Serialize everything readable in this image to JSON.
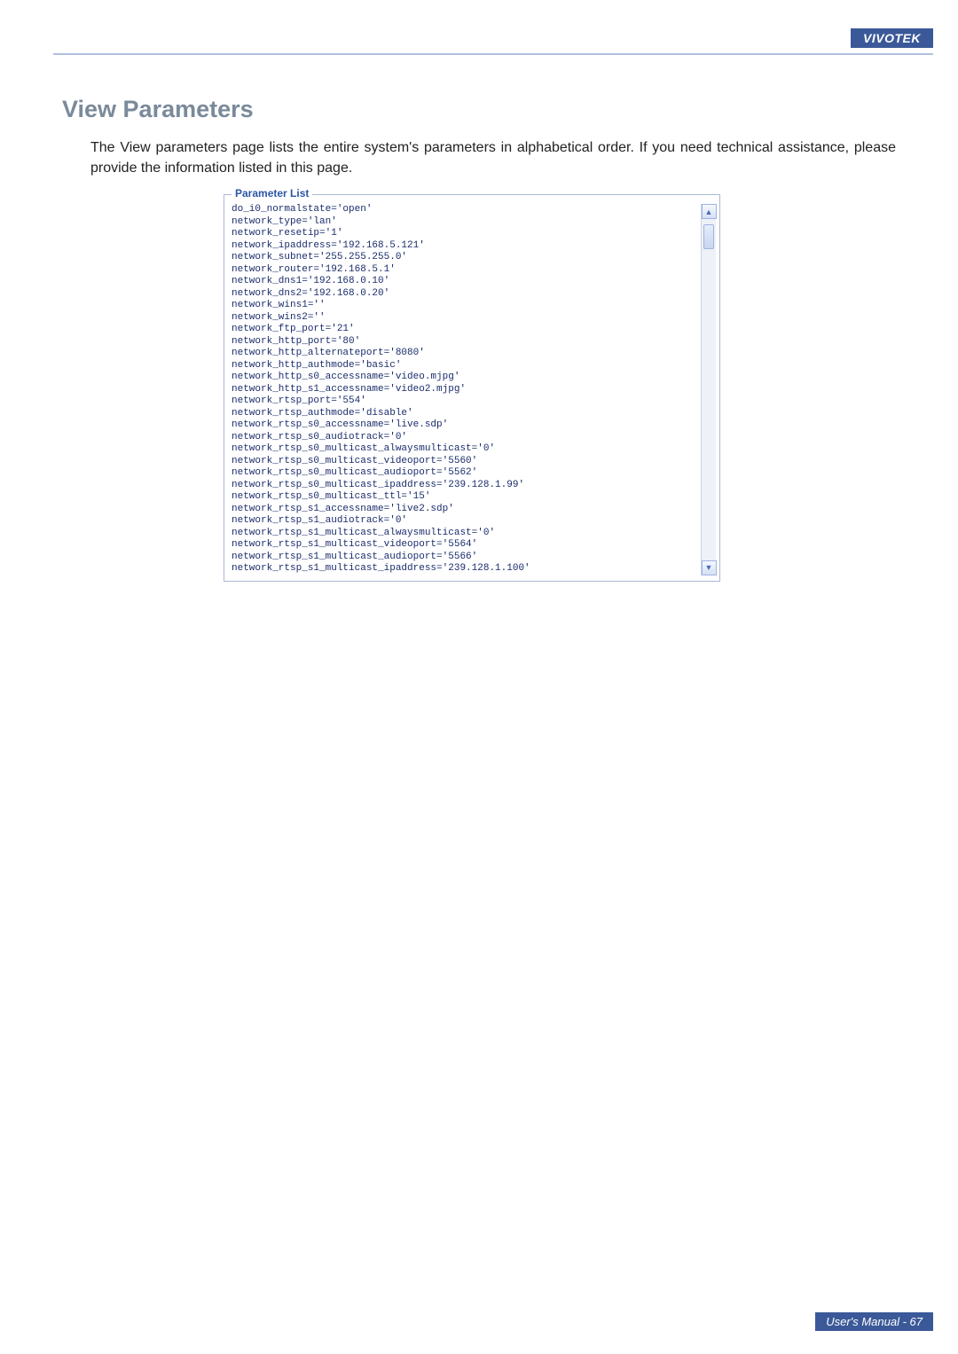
{
  "brand": "VIVOTEK",
  "title": "View Parameters",
  "intro": "The View parameters page lists the entire system's parameters in alphabetical order. If you need technical assistance, please provide the information listed in this page.",
  "panel_legend": "Parameter List",
  "parameters": [
    "do_i0_normalstate='open'",
    "network_type='lan'",
    "network_resetip='1'",
    "network_ipaddress='192.168.5.121'",
    "network_subnet='255.255.255.0'",
    "network_router='192.168.5.1'",
    "network_dns1='192.168.0.10'",
    "network_dns2='192.168.0.20'",
    "network_wins1=''",
    "network_wins2=''",
    "network_ftp_port='21'",
    "network_http_port='80'",
    "network_http_alternateport='8080'",
    "network_http_authmode='basic'",
    "network_http_s0_accessname='video.mjpg'",
    "network_http_s1_accessname='video2.mjpg'",
    "network_rtsp_port='554'",
    "network_rtsp_authmode='disable'",
    "network_rtsp_s0_accessname='live.sdp'",
    "network_rtsp_s0_audiotrack='0'",
    "network_rtsp_s0_multicast_alwaysmulticast='0'",
    "network_rtsp_s0_multicast_videoport='5560'",
    "network_rtsp_s0_multicast_audioport='5562'",
    "network_rtsp_s0_multicast_ipaddress='239.128.1.99'",
    "network_rtsp_s0_multicast_ttl='15'",
    "network_rtsp_s1_accessname='live2.sdp'",
    "network_rtsp_s1_audiotrack='0'",
    "network_rtsp_s1_multicast_alwaysmulticast='0'",
    "network_rtsp_s1_multicast_videoport='5564'",
    "network_rtsp_s1_multicast_audioport='5566'",
    "network_rtsp_s1_multicast_ipaddress='239.128.1.100'"
  ],
  "scroll_up_glyph": "▲",
  "scroll_down_glyph": "▼",
  "footer": "User's Manual - 67"
}
